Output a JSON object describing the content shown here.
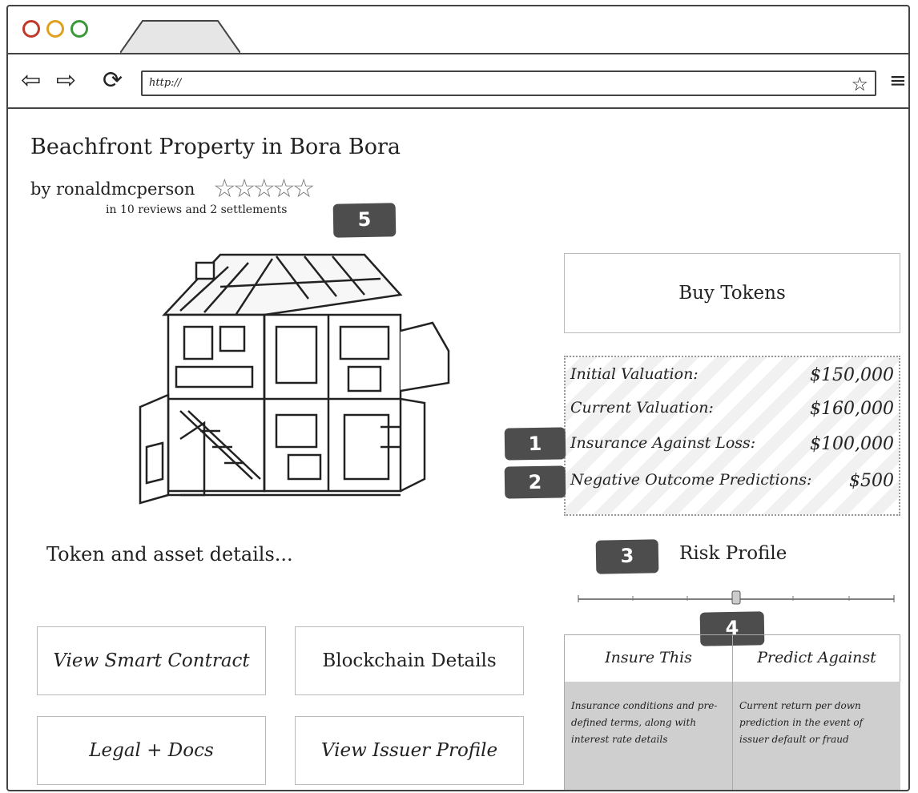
{
  "browser": {
    "url": "http://",
    "icons": [
      "back-arrow",
      "forward-arrow",
      "reload",
      "bookmark-star",
      "hamburger-menu"
    ]
  },
  "listing": {
    "title": "Beachfront Property in  Bora Bora",
    "byline": "by  ronaldmcperson",
    "rating_stars": 0,
    "rating_max": 5,
    "reviews_text": "in 10 reviews and 2 settlements"
  },
  "markers": {
    "m1": "1",
    "m2": "2",
    "m3": "3",
    "m4": "4",
    "m5": "5"
  },
  "actions": {
    "buy_tokens": "Buy Tokens"
  },
  "valuations": [
    {
      "label": "Initial Valuation:",
      "value": "$150,000"
    },
    {
      "label": "Current Valuation:",
      "value": "$160,000"
    },
    {
      "label": "Insurance Against Loss:",
      "value": "$100,000"
    },
    {
      "label": "Negative Outcome Predictions:",
      "value": "$500"
    }
  ],
  "token_details": "Token and asset details...",
  "risk_profile": {
    "label": "Risk Profile",
    "level": 0.5
  },
  "buttons": {
    "view_contract": "View Smart Contract",
    "blockchain": "Blockchain Details",
    "legal": "Legal + Docs",
    "issuer": "View Issuer Profile"
  },
  "insure_predict": {
    "insure_label": "Insure This",
    "predict_label": "Predict Against",
    "insure_text": "Insurance conditions and pre-defined terms, along with interest rate details",
    "predict_text": "Current return per down prediction in the event of issuer default or fraud"
  },
  "colors": {
    "dot_close": "#c0392b",
    "dot_min": "#e0a020",
    "dot_max": "#3a9a3a",
    "marker_bg": "#4d4d4d",
    "panel_body": "#cfcfcf"
  }
}
